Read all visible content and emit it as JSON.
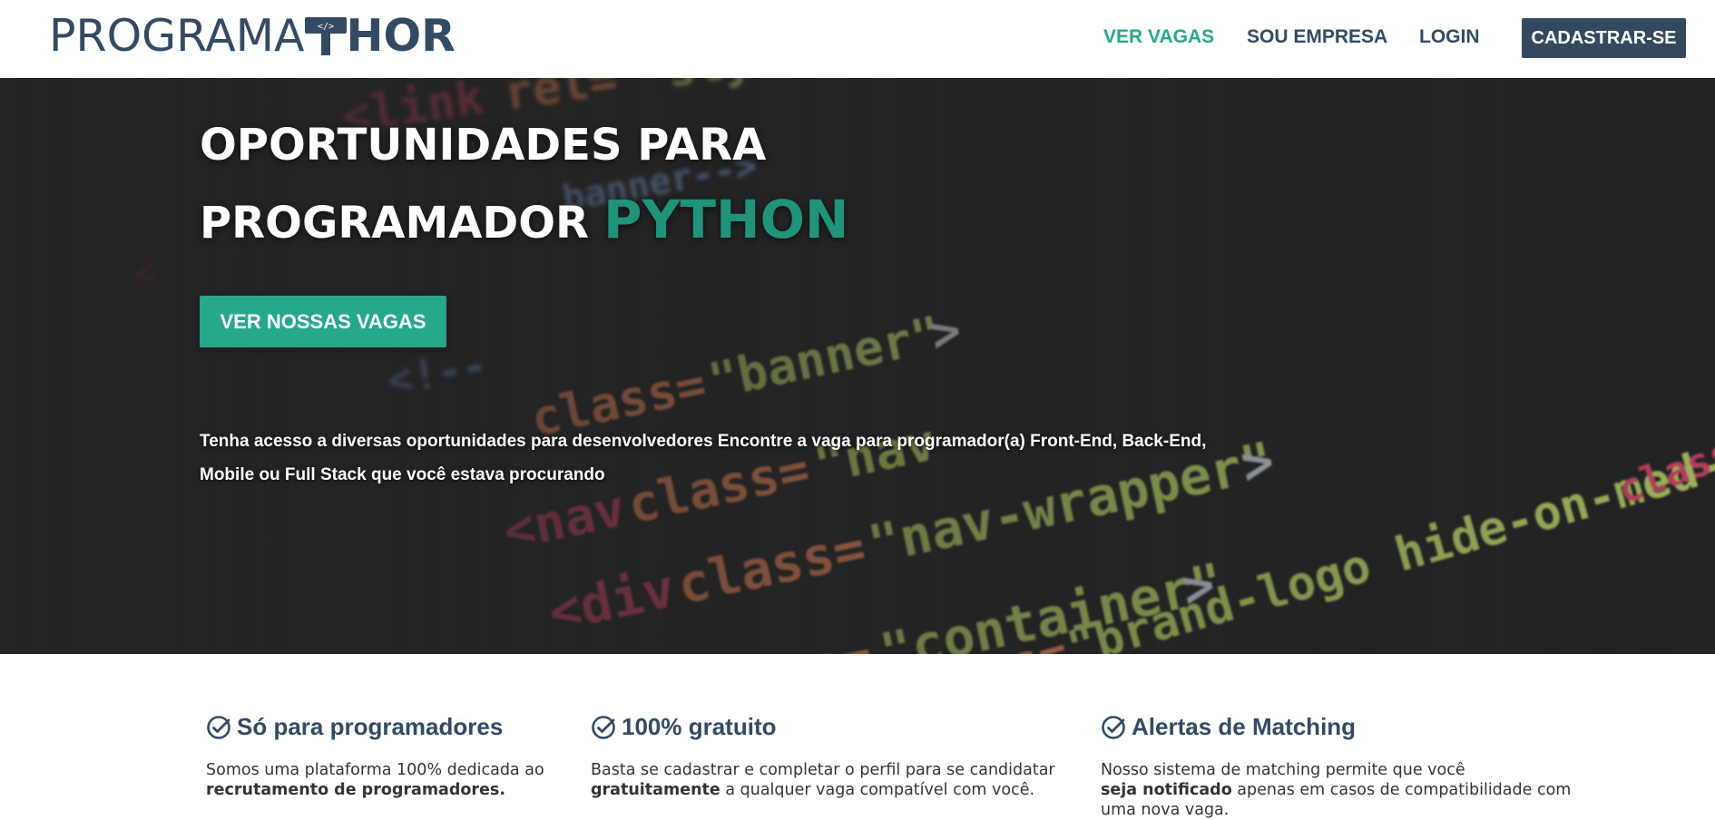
{
  "logo": {
    "text_left": "PROGRAMA",
    "text_right": "HOR",
    "hammer_glyph": "</>"
  },
  "nav": {
    "links": [
      "VER VAGAS",
      "SOU EMPRESA",
      "LOGIN"
    ],
    "signup_label": "CADASTRAR-SE"
  },
  "colors": {
    "primary": "#34495e",
    "accent": "#26a88b",
    "accent_dark": "#1f9478"
  },
  "hero": {
    "title_line1": "OPORTUNIDADES PARA",
    "title_line2": "PROGRAMADOR",
    "highlight": "PYTHON",
    "cta_label": "VER NOSSAS VAGAS",
    "description": "Tenha acesso a diversas oportunidades para desenvolvedores Encontre a vaga para programador(a) Front-End, Back-End, Mobile ou Full Stack que você estava procurando",
    "bg_code_lines": [
      "link rel=\"style",
      "banner-->",
      "<!--",
      "class=\"banner\">",
      "<nav class=\"nav",
      "<div class=\"nav-wrapper\">",
      "class=\"container\">",
      "class=\"brand-logo hide-on-med-and-up\"><span",
      "class=\"s"
    ]
  },
  "features": [
    {
      "icon": "check-circle-icon",
      "title": "Só para programadores",
      "text_before": "Somos uma plataforma 100% dedicada ao",
      "text_bold": "recrutamento de programadores.",
      "text_after": ""
    },
    {
      "icon": "check-circle-icon",
      "title": "100% gratuito",
      "text_before": "Basta se cadastrar e completar o perfil para se candidatar",
      "text_bold": "gratuitamente",
      "text_after": " a qualquer vaga compatível com você."
    },
    {
      "icon": "check-circle-icon",
      "title": "Alertas de Matching",
      "text_before": "Nosso sistema de matching permite que você",
      "text_bold": "seja notificado",
      "text_after": " apenas em casos de compatibilidade com uma nova vaga."
    }
  ]
}
